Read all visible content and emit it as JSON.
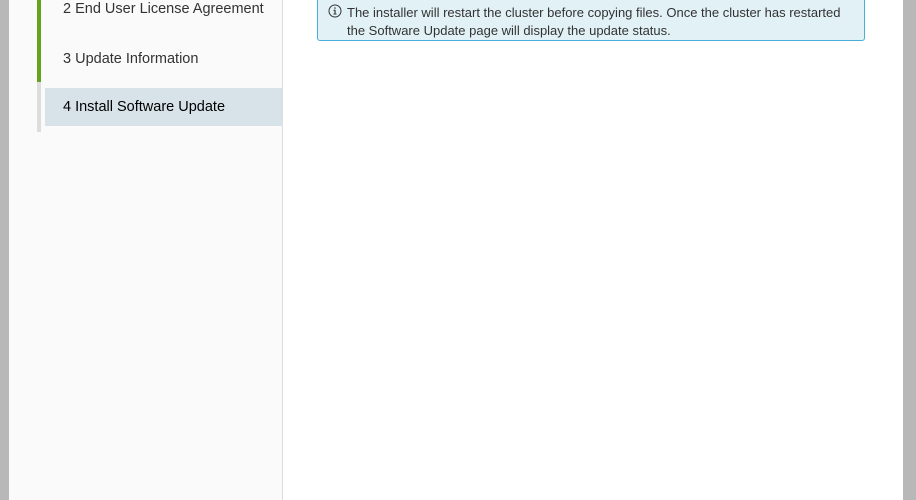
{
  "wizard": {
    "steps": [
      {
        "label": "2 End User License Agreement",
        "state": "completed"
      },
      {
        "label": "3 Update Information",
        "state": "completed"
      },
      {
        "label": "4 Install Software Update",
        "state": "current"
      }
    ]
  },
  "alert": {
    "type": "info",
    "icon": "info-icon",
    "text": "The installer will restart the cluster before copying files. Once the cluster has restarted the Software Update page will display the update status."
  },
  "colors": {
    "completed": "#62a420",
    "current_bg": "#d8e3e9",
    "alert_border": "#49afd9",
    "alert_bg": "#e1f1f6"
  }
}
